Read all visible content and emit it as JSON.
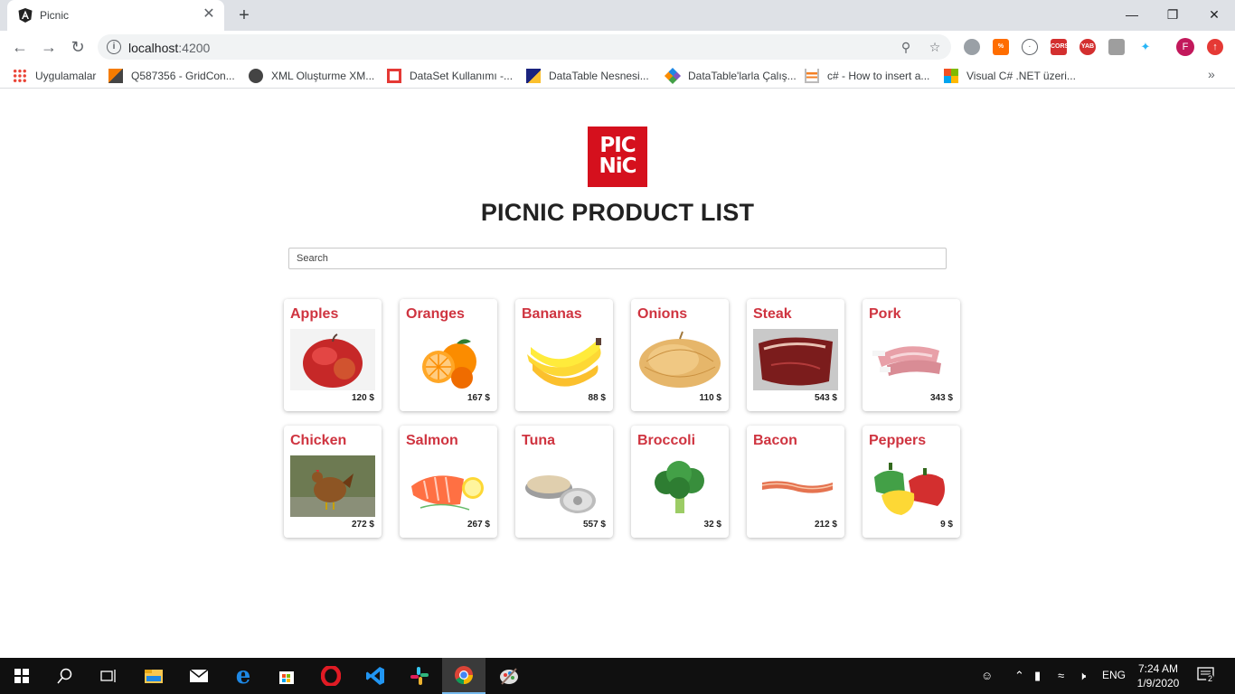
{
  "browser": {
    "tab_title": "Picnic",
    "url_host": "localhost",
    "url_port": ":4200",
    "bookmarks": [
      {
        "label": "Uygulamalar",
        "color": "#4285f4"
      },
      {
        "label": "Q587356 - GridCon...",
        "color": "#ff6d00"
      },
      {
        "label": "XML Oluşturme XM...",
        "color": "#444444"
      },
      {
        "label": "DataSet Kullanımı -...",
        "color": "#e53935"
      },
      {
        "label": "DataTable Nesnesi...",
        "color": "#1a237e"
      },
      {
        "label": "DataTable'larla Çalış...",
        "color": "#7e57c2"
      },
      {
        "label": "c# - How to insert a...",
        "color": "#f48024"
      },
      {
        "label": "Visual C# .NET üzeri...",
        "color": "#00a4ef"
      }
    ],
    "avatar_letter": "F"
  },
  "page": {
    "logo_line1": "PIC",
    "logo_line2": "NiC",
    "title": "PICNIC PRODUCT LIST",
    "search_placeholder": "Search"
  },
  "products": [
    {
      "name": "Apples",
      "price": "120 $",
      "icon": "apple-image"
    },
    {
      "name": "Oranges",
      "price": "167 $",
      "icon": "orange-image"
    },
    {
      "name": "Bananas",
      "price": "88 $",
      "icon": "banana-image"
    },
    {
      "name": "Onions",
      "price": "110 $",
      "icon": "onion-image"
    },
    {
      "name": "Steak",
      "price": "543 $",
      "icon": "steak-image"
    },
    {
      "name": "Pork",
      "price": "343 $",
      "icon": "pork-image"
    },
    {
      "name": "Chicken",
      "price": "272 $",
      "icon": "chicken-image"
    },
    {
      "name": "Salmon",
      "price": "267 $",
      "icon": "salmon-image"
    },
    {
      "name": "Tuna",
      "price": "557 $",
      "icon": "tuna-image"
    },
    {
      "name": "Broccoli",
      "price": "32 $",
      "icon": "broccoli-image"
    },
    {
      "name": "Bacon",
      "price": "212 $",
      "icon": "bacon-image"
    },
    {
      "name": "Peppers",
      "price": "9 $",
      "icon": "peppers-image"
    }
  ],
  "taskbar": {
    "language": "ENG",
    "time": "7:24 AM",
    "date": "1/9/2020",
    "notification_count": "2"
  },
  "colors": {
    "brand_red": "#d5101d",
    "product_name": "#cf3440"
  }
}
